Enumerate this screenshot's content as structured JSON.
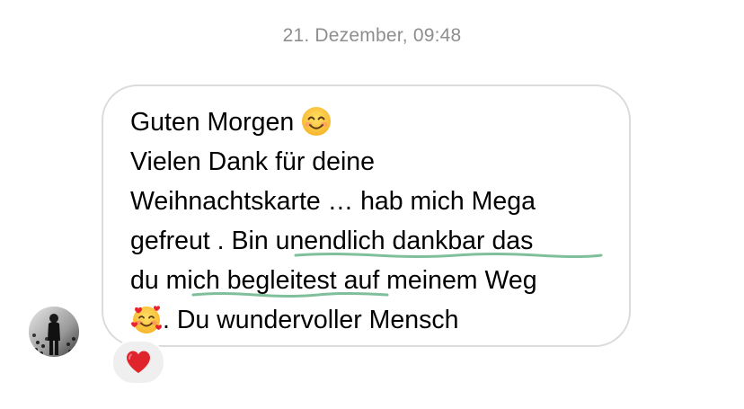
{
  "thread": {
    "timestamp": "21. Dezember, 09:48"
  },
  "message": {
    "line1_text": "Guten Morgen ",
    "line1_emoji": "smiling-face-with-smiling-eyes",
    "line2_text": "Vielen Dank für deine",
    "line3_text": "Weihnachtskarte … hab mich Mega",
    "line4_pre": "gefreut . Bin ",
    "line4_link": "unendlich dankbar das",
    "line5_link": "du mich begleitest",
    "line5_post": " auf meinem Weg",
    "line6_emoji": "smiling-face-with-hearts",
    "line6_text": ". Du wundervoller Mensch",
    "underline_color": "#7fbf9a"
  },
  "sender": {
    "avatar_icon": "profile-photo"
  },
  "reaction": {
    "icon": "red-heart",
    "color": "#e0242b"
  }
}
